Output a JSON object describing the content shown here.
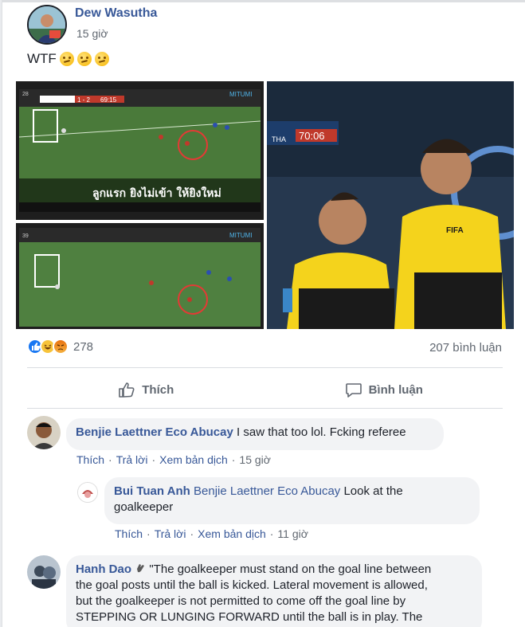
{
  "post": {
    "author": "Dew Wasutha",
    "time": "15 giờ",
    "text": "WTF",
    "emojis": [
      "thinking-face",
      "thinking-face",
      "thinking-face"
    ],
    "photos": [
      {
        "overlay_text": "ลูกแรก ยิงไม่เข้า ให้ยิงใหม่",
        "score": "1 - 2",
        "clock": "69:15",
        "brand": "MITUMI",
        "views": "28"
      },
      {
        "brand": "MITUMI",
        "views": "39"
      },
      {
        "clock": "70:06",
        "team": "THA",
        "badge": "FIFA"
      }
    ],
    "reactions": {
      "count": "278",
      "types": [
        "like",
        "haha",
        "angry"
      ]
    },
    "comments_count": "207 bình luận",
    "actions": {
      "like": "Thích",
      "comment": "Bình luận"
    }
  },
  "comments": [
    {
      "name": "Benjie Laettner Eco Abucay",
      "text": "I saw that too lol. Fcking referee",
      "actions": [
        "Thích",
        "Trả lời",
        "Xem bản dịch",
        "15 giờ"
      ]
    },
    {
      "name": "Bui Tuan Anh",
      "mention": "Benjie Laettner Eco Abucay",
      "text_line1": "Look at the",
      "text_line2": "goalkeeper",
      "actions": [
        "Thích",
        "Trả lời",
        "Xem bản dịch",
        "11 giờ"
      ]
    },
    {
      "name": "Hanh Dao",
      "lines": [
        "\"The goalkeeper must stand on the goal line between",
        "the goal posts until the ball is kicked. Lateral movement is allowed,",
        "but the goalkeeper is not permitted to come off the goal line by",
        "STEPPING OR LUNGING FORWARD until the ball is in play. The"
      ]
    }
  ]
}
